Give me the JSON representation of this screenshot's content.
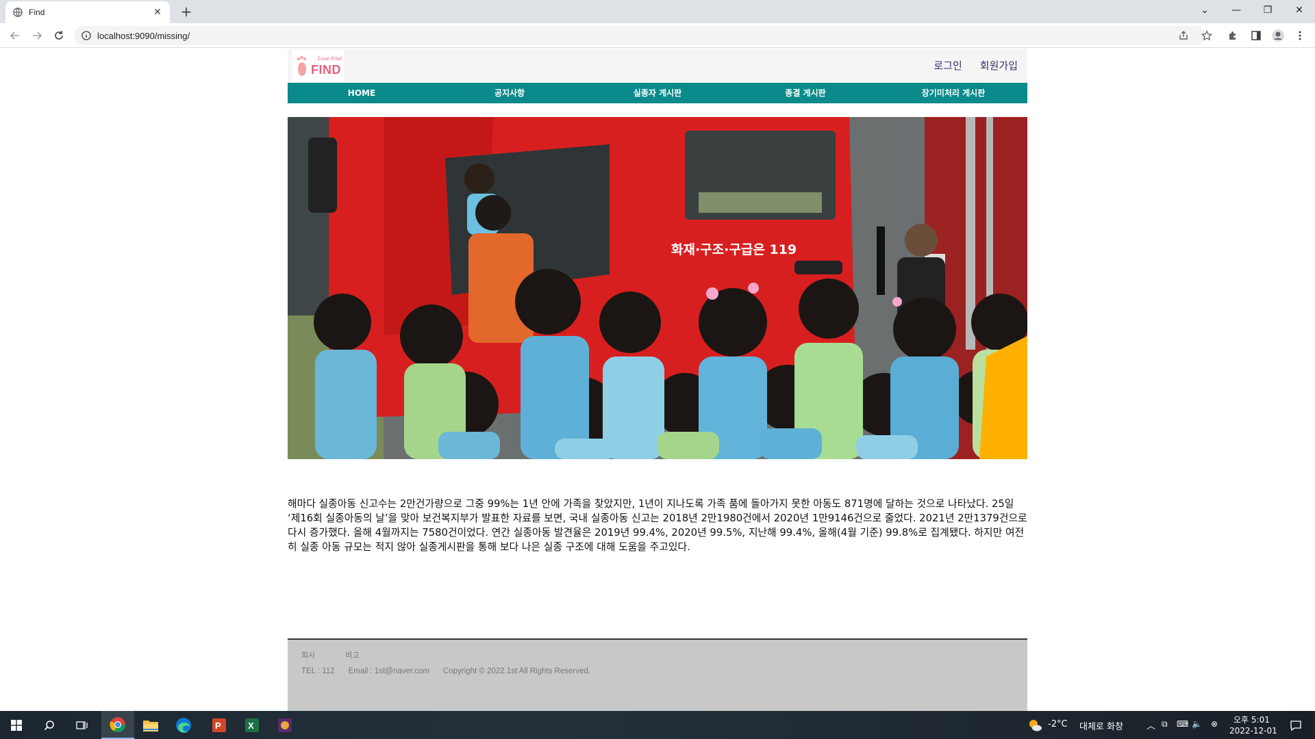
{
  "browser": {
    "tab_title": "Find",
    "url": "localhost:9090/missing/"
  },
  "site": {
    "logo_text": "FIND",
    "logo_tagline": "Love Find",
    "auth": {
      "login": "로그인",
      "signup": "회원가입"
    },
    "nav": [
      "HOME",
      "공지사항",
      "실종자 게시판",
      "종결 게시판",
      "장기미처리 게시판"
    ],
    "hero_sign": "화재·구조·구급은 119",
    "article": "해마다 실종아동 신고수는 2만건가량으로 그중 99%는 1년 안에 가족을 찾았지만, 1년이 지나도록 가족 품에 돌아가지 못한 아동도 871명에 달하는 것으로 나타났다. 25일 ‘제16회 실종아동의 날’을 맞아 보건복지부가 발표한 자료를 보면, 국내 실종아동 신고는 2018년 2만1980건에서 2020년 1만9146건으로 줄었다. 2021년 2만1379건으로 다시 증가했다. 올해 4월까지는 7580건이었다. 연간 실종아동 발견율은 2019년 99.4%, 2020년 99.5%, 지난해 99.4%, 올해(4월 기준) 99.8%로 집계됐다. 하지만 여전히 실종 아동 규모는 적지 않아 실종게시판을 통해 보다 나은 실종 구조에 대해 도움을 주고있다.",
    "footer": {
      "company_label": "회사",
      "note_label": "비고",
      "tel": "TEL : 112",
      "email": "Email : 1st@naver.com",
      "copyright": "Copyright © 2022.1st All Rights Reserved."
    }
  },
  "taskbar": {
    "weather_temp": "-2°C",
    "weather_desc": "대체로 화창",
    "time": "오후 5:01",
    "date": "2022-12-01"
  },
  "colors": {
    "nav_bg": "#0a8a8a",
    "auth_link": "#3a2a6e",
    "logo": "#e8607f",
    "footer_bg": "#c8c8c8"
  }
}
